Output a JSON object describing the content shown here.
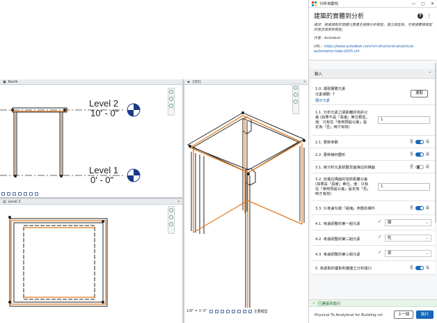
{
  "views": {
    "elevation_tab": "North",
    "plan_tab": "Level 2",
    "view3d_tab": "{3D}",
    "level2": {
      "name": "Level 2",
      "elev": "10' - 0\""
    },
    "level1": {
      "name": "Level 1",
      "elev": "0' - 0\""
    },
    "scale": "1/8\" = 1'-0\"",
    "view_model": "主要模型"
  },
  "panel": {
    "window_title": "分析自動化",
    "controls": [
      "—",
      "▢",
      "✕"
    ],
    "title": "建築的實體到分析",
    "description": "描述：根據選取的實體元素產生相應分析模型，建立模型後，可根據要建模型的需求再更新模型。",
    "author": "作者：Autodesk",
    "url_label": "URL：",
    "url": "https://www.autodesk.com/rvt-structural-analytical-automation-help-2025-cht",
    "section_input": "輸入",
    "select": {
      "title": "1.0. 選取實體元素",
      "count": "元素總數: 7",
      "link": "展示元素",
      "button": "選取"
    },
    "offset": {
      "text": "1.1. 分析元素之間距離的容許公差 (如果不是「長度」單位類型，值：只有在「使用預設公差」設定為「否」時才有效)",
      "value": "1"
    },
    "t21": {
      "label": "2.1. 更新參數",
      "no": "否",
      "yes": "是"
    },
    "t22": {
      "label": "2.2. 更新幾何圖形",
      "no": "否",
      "yes": "是"
    },
    "t31": {
      "label": "3.1. 將分析元素調整至面接近的構面",
      "no": "否",
      "yes": "是"
    },
    "t32": {
      "text": "3.2. 自最近構面的容許距離公差 (如果是「長度」單位，值：只有在「使用預設公差」設定為「否」時才有效)",
      "value": "1"
    },
    "t33": {
      "label": "3.3. 只考慮勾選「組塊」參數的構件",
      "no": "否",
      "yes": "是"
    },
    "s41": {
      "label": "4.1. 考慮調整的第一組元素",
      "value": "牆"
    },
    "s42": {
      "label": "4.2. 考慮調整的第二組元素",
      "value": "柱"
    },
    "s43": {
      "label": "4.3. 考慮調整的第三組元素",
      "value": "梁"
    },
    "t5": {
      "label": "5. 為選取的樓板和牆建立分析開口",
      "no": "否",
      "yes": "是"
    },
    "status": "已連接到執行",
    "file": "Physical To Analytical for Building.rvt",
    "back": "上一個",
    "run": "執行"
  },
  "colors": {
    "accent": "#1767b8",
    "orange": "#e07a1f",
    "toggle_on": "#1767b8",
    "toggle_off": "#9aa0a6"
  }
}
